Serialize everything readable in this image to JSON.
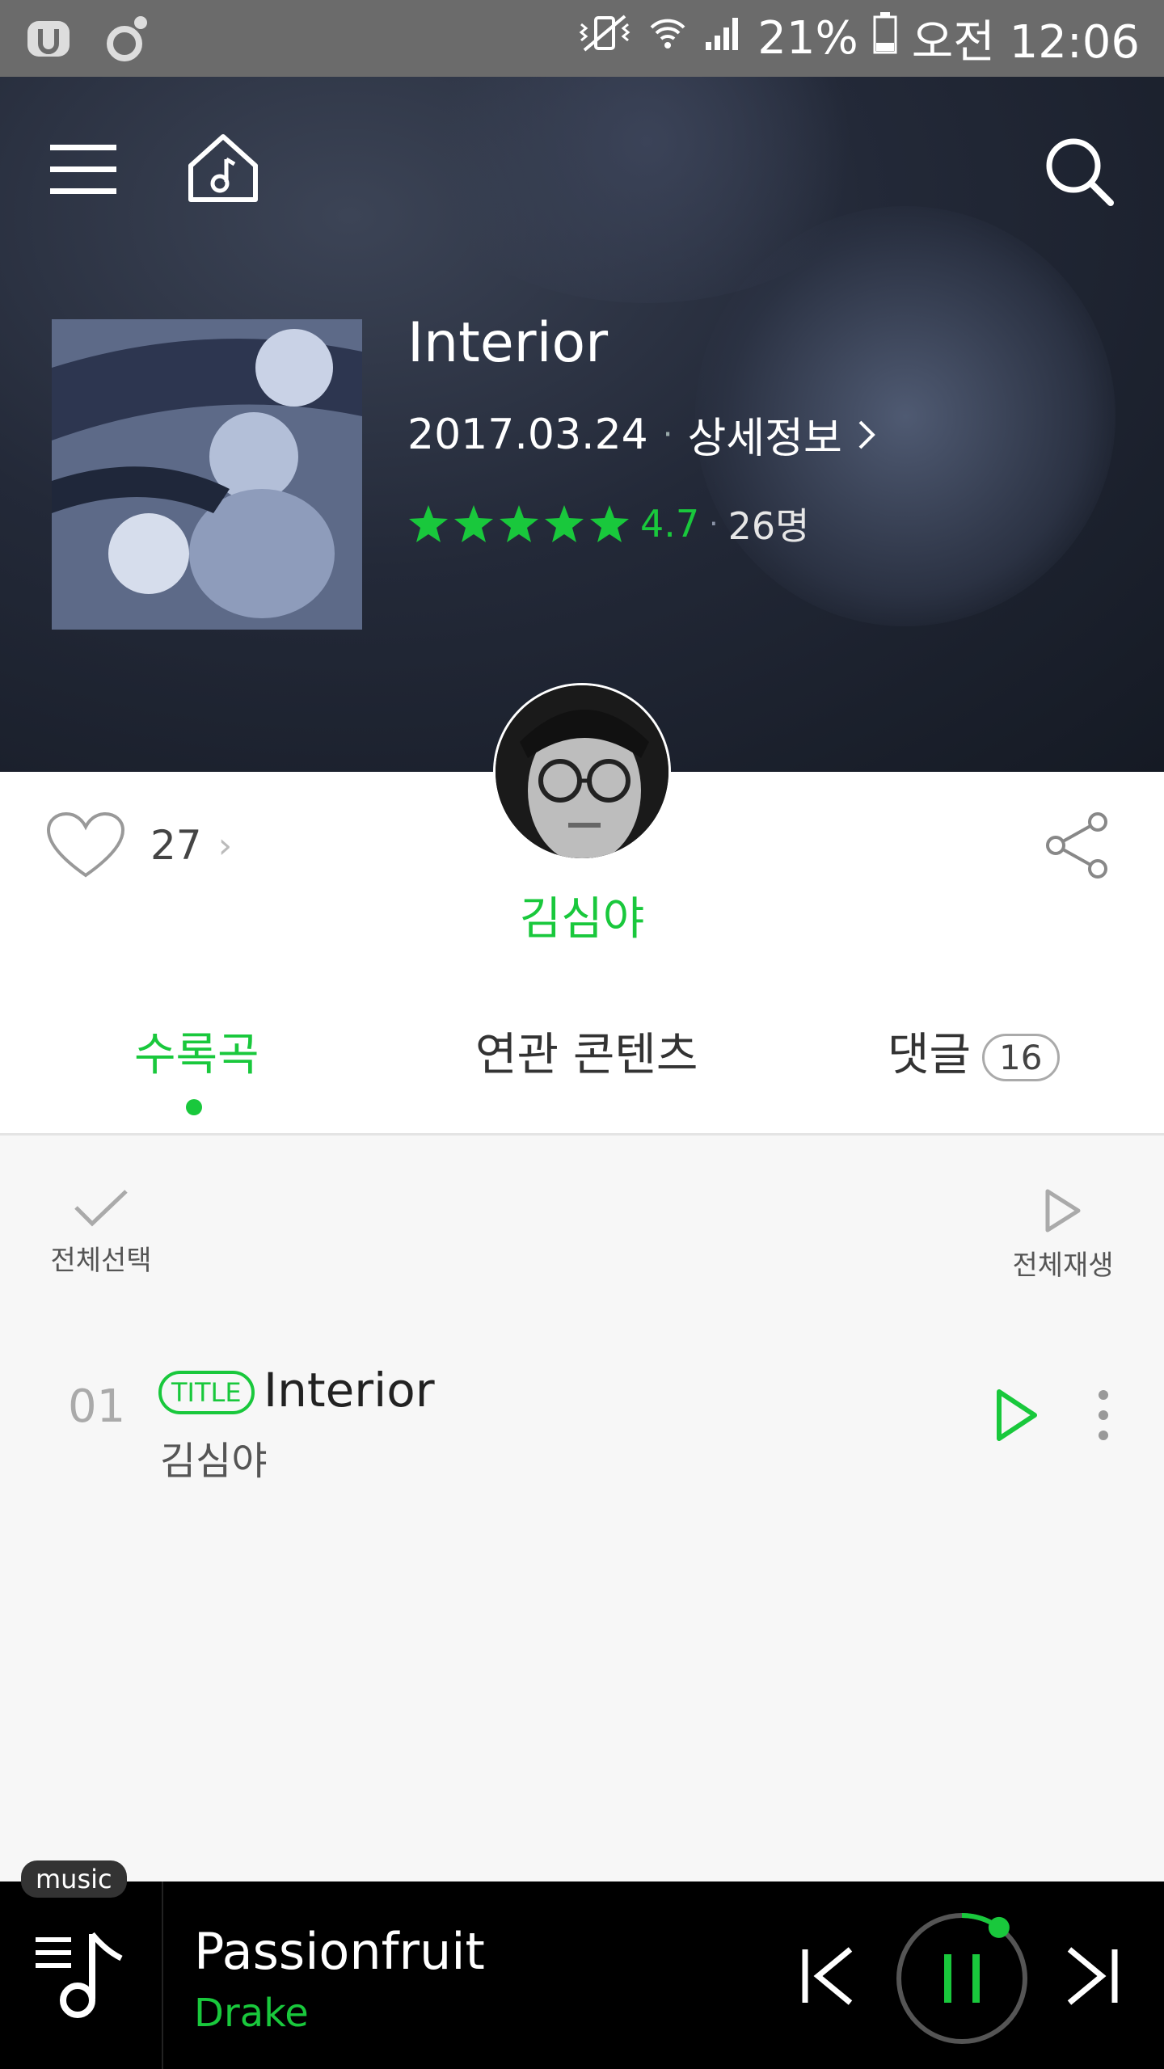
{
  "status_bar": {
    "battery": "21%",
    "time": "오전 12:06"
  },
  "album": {
    "title": "Interior",
    "date": "2017.03.24",
    "detail_label": "상세정보",
    "rating": "4.7",
    "rating_fraction": 0.94,
    "rating_count": "26명"
  },
  "likes": {
    "count": "27"
  },
  "artist": {
    "name": "김심야"
  },
  "tabs": [
    {
      "label": "수록곡",
      "active": true
    },
    {
      "label": "연관 콘텐츠",
      "active": false
    },
    {
      "label": "댓글",
      "badge": "16",
      "active": false
    }
  ],
  "list_controls": {
    "select_all": "전체선택",
    "play_all": "전체재생"
  },
  "tracks": [
    {
      "number": "01",
      "badge": "TITLE",
      "title": "Interior",
      "artist": "김심야"
    }
  ],
  "player": {
    "tag": "music",
    "title": "Passionfruit",
    "artist": "Drake",
    "progress_fraction": 0.1
  },
  "colors": {
    "accent": "#19c83c",
    "player_bg": "#000000",
    "status_bar": "#6b6b6b"
  }
}
